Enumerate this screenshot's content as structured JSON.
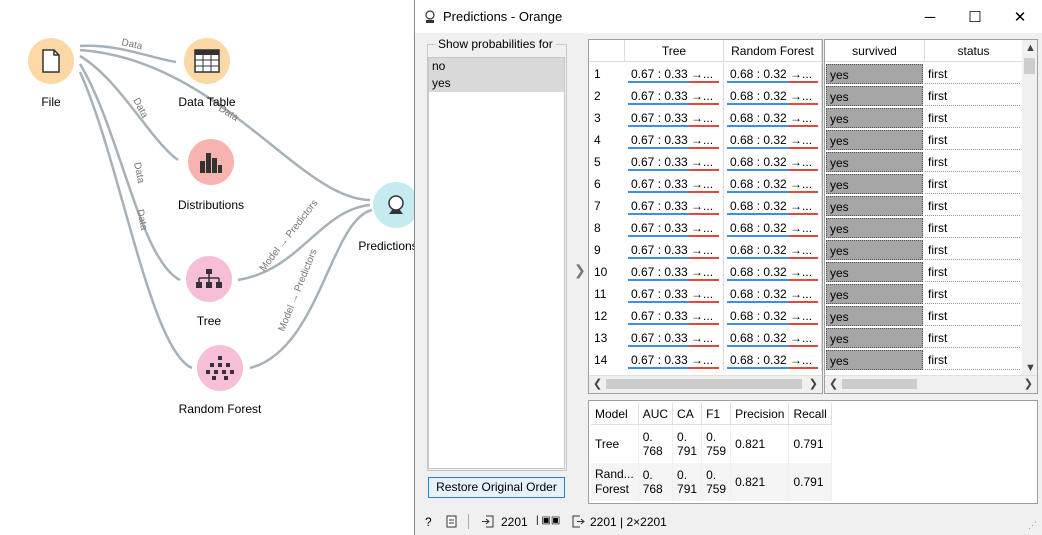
{
  "canvas": {
    "nodes": {
      "file": {
        "label": "File"
      },
      "data_table": {
        "label": "Data Table"
      },
      "distributions": {
        "label": "Distributions"
      },
      "tree": {
        "label": "Tree"
      },
      "random_forest": {
        "label": "Random Forest"
      },
      "predictions": {
        "label": "Predictions"
      }
    },
    "links": {
      "file_datatable": "Data",
      "file_distributions": "Data",
      "file_tree": "Data",
      "file_forest": "Data",
      "file_predictions": "Data",
      "tree_predictions": "Model → Predictors",
      "forest_predictions": "Model → Predictors"
    }
  },
  "window": {
    "title": "Predictions - Orange",
    "controls": {
      "minimize": "─",
      "maximize": "☐",
      "close": "✕"
    }
  },
  "probabilities": {
    "title": "Show probabilities for",
    "items": [
      "no",
      "yes"
    ],
    "restore_label": "Restore Original Order"
  },
  "predictions_table": {
    "headers": {
      "tree": "Tree",
      "forest": "Random Forest"
    },
    "rows": [
      {
        "n": "1",
        "tree": "0.67 : 0.33 →...",
        "forest": "0.68 : 0.32 →..."
      },
      {
        "n": "2",
        "tree": "0.67 : 0.33 →...",
        "forest": "0.68 : 0.32 →..."
      },
      {
        "n": "3",
        "tree": "0.67 : 0.33 →...",
        "forest": "0.68 : 0.32 →..."
      },
      {
        "n": "4",
        "tree": "0.67 : 0.33 →...",
        "forest": "0.68 : 0.32 →..."
      },
      {
        "n": "5",
        "tree": "0.67 : 0.33 →...",
        "forest": "0.68 : 0.32 →..."
      },
      {
        "n": "6",
        "tree": "0.67 : 0.33 →...",
        "forest": "0.68 : 0.32 →..."
      },
      {
        "n": "7",
        "tree": "0.67 : 0.33 →...",
        "forest": "0.68 : 0.32 →..."
      },
      {
        "n": "8",
        "tree": "0.67 : 0.33 →...",
        "forest": "0.68 : 0.32 →..."
      },
      {
        "n": "9",
        "tree": "0.67 : 0.33 →...",
        "forest": "0.68 : 0.32 →..."
      },
      {
        "n": "10",
        "tree": "0.67 : 0.33 →...",
        "forest": "0.68 : 0.32 →..."
      },
      {
        "n": "11",
        "tree": "0.67 : 0.33 →...",
        "forest": "0.68 : 0.32 →..."
      },
      {
        "n": "12",
        "tree": "0.67 : 0.33 →...",
        "forest": "0.68 : 0.32 →..."
      },
      {
        "n": "13",
        "tree": "0.67 : 0.33 →...",
        "forest": "0.68 : 0.32 →..."
      },
      {
        "n": "14",
        "tree": "0.67 : 0.33 →...",
        "forest": "0.68 : 0.32 →..."
      }
    ]
  },
  "data_table": {
    "headers": {
      "survived": "survived",
      "status": "status"
    },
    "rows": [
      {
        "survived": "yes",
        "status": "first"
      },
      {
        "survived": "yes",
        "status": "first"
      },
      {
        "survived": "yes",
        "status": "first"
      },
      {
        "survived": "yes",
        "status": "first"
      },
      {
        "survived": "yes",
        "status": "first"
      },
      {
        "survived": "yes",
        "status": "first"
      },
      {
        "survived": "yes",
        "status": "first"
      },
      {
        "survived": "yes",
        "status": "first"
      },
      {
        "survived": "yes",
        "status": "first"
      },
      {
        "survived": "yes",
        "status": "first"
      },
      {
        "survived": "yes",
        "status": "first"
      },
      {
        "survived": "yes",
        "status": "first"
      },
      {
        "survived": "yes",
        "status": "first"
      },
      {
        "survived": "yes",
        "status": "first"
      }
    ]
  },
  "scores": {
    "headers": [
      "Model",
      "AUC",
      "CA",
      "F1",
      "Precision",
      "Recall"
    ],
    "rows": [
      {
        "model": "Tree",
        "auc": "0.\n768",
        "ca": "0.\n791",
        "f1": "0.\n759",
        "precision": "0.821",
        "recall": "0.791"
      },
      {
        "model": "Rand...\nForest",
        "auc": "0.\n768",
        "ca": "0.\n791",
        "f1": "0.\n759",
        "precision": "0.821",
        "recall": "0.791"
      }
    ]
  },
  "statusbar": {
    "input_count": "2201",
    "output_summary": "2201 | 2×2201"
  },
  "colors": {
    "file": "#fbd8a6",
    "data_table": "#fbd8a6",
    "distributions": "#f7b4ae",
    "tree": "#f7bfd7",
    "random_forest": "#f7bfd7",
    "predictions": "#c5ebf0",
    "prob_blue": "#3c8ee8",
    "prob_red": "#e2483b"
  }
}
